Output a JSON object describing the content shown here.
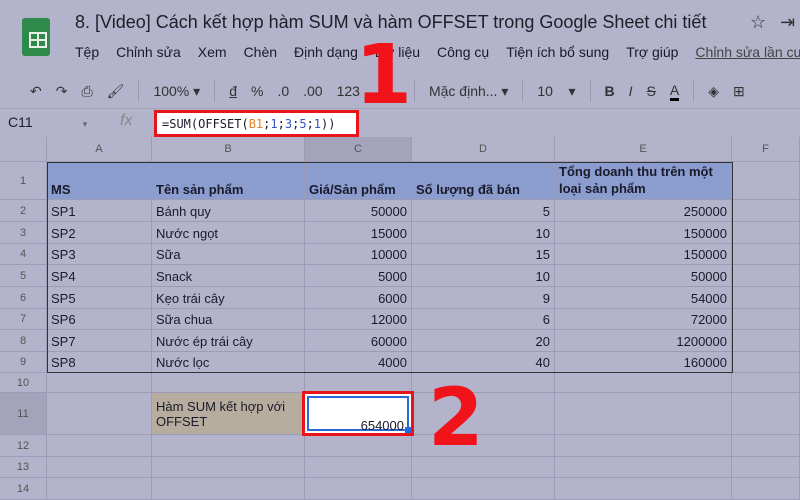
{
  "doc_title": "8. [Video] Cách kết hợp hàm SUM và hàm OFFSET trong Google Sheet chi tiết",
  "menu": [
    "Tệp",
    "Chỉnh sửa",
    "Xem",
    "Chèn",
    "Định dạng",
    "Dữ liệu",
    "Công cụ",
    "Tiện ích bổ sung",
    "Trợ giúp"
  ],
  "last_edit": "Chỉnh sửa lần cuối",
  "toolbar": {
    "zoom": "100%",
    "currency": "đ",
    "percent": "%",
    "dec_less": ".0",
    "dec_more": ".00",
    "format": "123",
    "font": "Mặc định...",
    "size": "10",
    "bold": "B",
    "italic": "I",
    "strike": "S",
    "text_color": "A"
  },
  "name_box": "C11",
  "fx": "fx",
  "formula": {
    "p1": "=SUM(OFFSET(",
    "ref": "B1",
    "s1": ";",
    "a": "1",
    "s2": ";",
    "b": "3",
    "s3": ";",
    "c": "5",
    "s4": ";",
    "d": "1",
    "p2": "))"
  },
  "columns": [
    "A",
    "B",
    "C",
    "D",
    "E",
    "F"
  ],
  "rows": [
    "1",
    "2",
    "3",
    "4",
    "5",
    "6",
    "7",
    "8",
    "9",
    "10",
    "11",
    "12",
    "13",
    "14"
  ],
  "headers": [
    "MS",
    "Tên sản phẩm",
    "Giá/Sản phẩm",
    "Số lượng đã bán",
    "Tổng doanh thu trên một loại sản phẩm"
  ],
  "data": [
    [
      "SP1",
      "Bánh quy",
      "50000",
      "5",
      "250000"
    ],
    [
      "SP2",
      "Nước ngọt",
      "15000",
      "10",
      "150000"
    ],
    [
      "SP3",
      "Sữa",
      "10000",
      "15",
      "150000"
    ],
    [
      "SP4",
      "Snack",
      "5000",
      "10",
      "50000"
    ],
    [
      "SP5",
      "Kẹo trái cây",
      "6000",
      "9",
      "54000"
    ],
    [
      "SP6",
      "Sữa chua",
      "12000",
      "6",
      "72000"
    ],
    [
      "SP7",
      "Nước ép trái cây",
      "60000",
      "20",
      "1200000"
    ],
    [
      "SP8",
      "Nước lọc",
      "4000",
      "40",
      "160000"
    ]
  ],
  "result_label": "Hàm SUM kết hợp với OFFSET",
  "result_value": "654000",
  "annotations": [
    "1",
    "2"
  ]
}
